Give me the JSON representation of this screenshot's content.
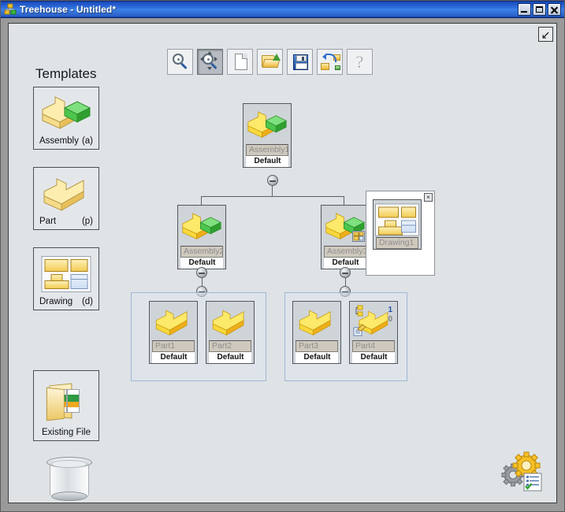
{
  "window": {
    "title": "Treehouse - Untitled*",
    "app_icon": "treehouse-icon",
    "minimize_label": "Minimize",
    "maximize_label": "Maximize",
    "close_label": "Close"
  },
  "toolbar": {
    "buttons": [
      {
        "name": "zoom-fit",
        "label": "Zoom to Fit",
        "icon": "magnifier-icon",
        "pressed": false
      },
      {
        "name": "zoom-region",
        "label": "Zoom to Region",
        "icon": "magnifier-pan-icon",
        "pressed": true
      },
      {
        "name": "new",
        "label": "New",
        "icon": "page-icon",
        "pressed": false
      },
      {
        "name": "open",
        "label": "Open",
        "icon": "folder-open-icon",
        "pressed": false
      },
      {
        "name": "save",
        "label": "Save",
        "icon": "floppy-disk-icon",
        "pressed": false
      },
      {
        "name": "export",
        "label": "Export Tree",
        "icon": "export-tree-icon",
        "pressed": false
      },
      {
        "name": "help",
        "label": "Help",
        "icon": "question-mark-icon",
        "glyph": "?",
        "pressed": false
      }
    ]
  },
  "canvas": {
    "collapse_button_glyph": "↙",
    "collapse_button_name": "collapse-corner-button",
    "settings_icon": "gears-checklist-icon",
    "trash_icon": "trash-bin-icon"
  },
  "templates": {
    "heading": "Templates",
    "items": [
      {
        "name": "template-assembly",
        "label": "Assembly",
        "shortcut": "(a)",
        "icon": "assembly-block-icon"
      },
      {
        "name": "template-part",
        "label": "Part",
        "shortcut": "(p)",
        "icon": "part-block-icon"
      },
      {
        "name": "template-drawing",
        "label": "Drawing",
        "shortcut": "(d)",
        "icon": "drawing-sheet-icon"
      },
      {
        "name": "template-existing-file",
        "label": "Existing File",
        "shortcut": "",
        "icon": "open-folder-files-icon"
      }
    ]
  },
  "tree": {
    "root": {
      "name": "Assembly1",
      "config": "Default",
      "icon": "assembly-block-icon"
    },
    "level2": [
      {
        "name": "Assembly2",
        "config": "Default",
        "icon": "assembly-block-icon",
        "badge": null
      },
      {
        "name": "Assembly3",
        "config": "Default",
        "icon": "assembly-block-icon",
        "badge": "drawing-sheet-badge"
      }
    ],
    "drawing_panel": {
      "name": "Drawing1",
      "icon": "drawing-sheet-icon",
      "close_glyph": "×"
    },
    "group_left": [
      {
        "name": "Part1",
        "config": "Default",
        "icon": "part-block-icon"
      },
      {
        "name": "Part2",
        "config": "Default",
        "icon": "part-block-icon"
      }
    ],
    "group_right": [
      {
        "name": "Part3",
        "config": "Default",
        "icon": "part-block-icon"
      },
      {
        "name": "Part4",
        "config": "Default",
        "icon": "part-block-icon",
        "badges": {
          "part_ref": "part-ref-badge",
          "note": "note-edit-badge",
          "count_top": "1",
          "count_bottom": "0"
        }
      }
    ]
  },
  "colors": {
    "titlebar_blue": "#1b4dbe",
    "canvas_bg": "#dfe3e6",
    "node_bg": "#cfd4d8",
    "name_field_bg": "#cfc9bd",
    "group_border": "#9fb6d4",
    "yellow": "#f3cd55",
    "green": "#3fb83f",
    "badge_blue": "#1f4fa8",
    "badge_gray": "#7d8288"
  }
}
